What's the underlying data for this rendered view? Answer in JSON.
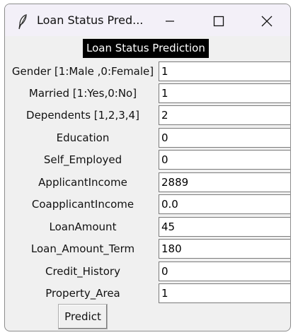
{
  "window": {
    "title": "Loan Status Pred...",
    "controls": {
      "minimize_icon": "minimize-icon",
      "maximize_icon": "maximize-icon",
      "close_icon": "close-icon"
    }
  },
  "heading": "Loan Status Prediction",
  "fields": [
    {
      "label": "Gender [1:Male ,0:Female]",
      "value": "1"
    },
    {
      "label": "Married [1:Yes,0:No]",
      "value": "1"
    },
    {
      "label": "Dependents [1,2,3,4]",
      "value": "2"
    },
    {
      "label": "Education",
      "value": "0"
    },
    {
      "label": "Self_Employed",
      "value": "0"
    },
    {
      "label": "ApplicantIncome",
      "value": "2889"
    },
    {
      "label": "CoapplicantIncome",
      "value": "0.0"
    },
    {
      "label": "LoanAmount",
      "value": "45"
    },
    {
      "label": "Loan_Amount_Term",
      "value": "180"
    },
    {
      "label": "Credit_History",
      "value": "0"
    },
    {
      "label": "Property_Area",
      "value": "1"
    }
  ],
  "predict_button": "Predict"
}
